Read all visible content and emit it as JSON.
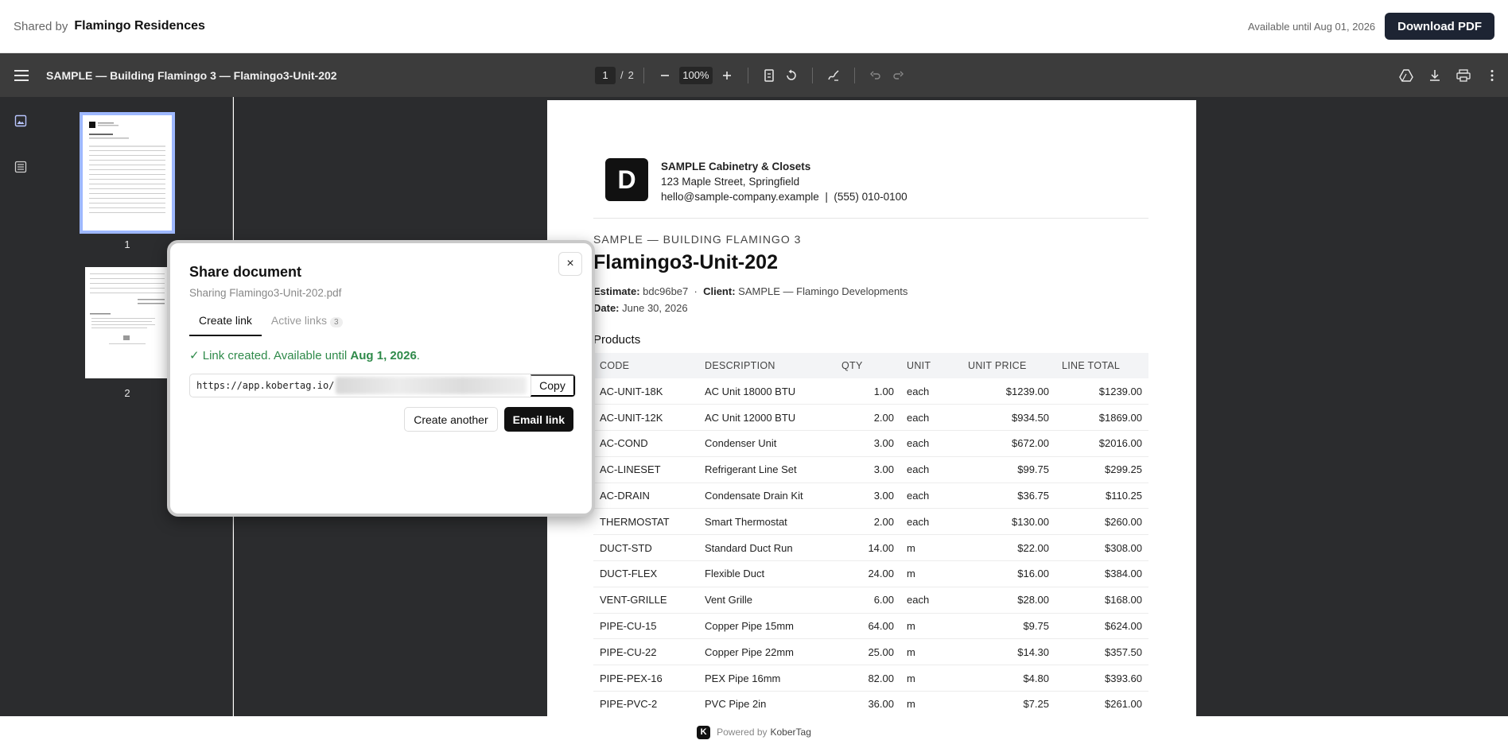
{
  "topbar": {
    "shared_by_label": "Shared by",
    "owner": "Flamingo Residences",
    "available": "Available until Aug 01, 2026",
    "download_label": "Download PDF"
  },
  "toolbar": {
    "doc_title": "SAMPLE — Building Flamingo 3 — Flamingo3-Unit-202",
    "page_current": "1",
    "page_sep": "/",
    "page_total": "2",
    "zoom": "100%"
  },
  "thumbnails": [
    {
      "number": "1",
      "selected": true
    },
    {
      "number": "2",
      "selected": false
    }
  ],
  "document": {
    "logo_letter": "D",
    "company_name": "SAMPLE Cabinetry & Closets",
    "address": "123 Maple Street, Springfield",
    "email": "hello@sample-company.example",
    "phone_sep": "|",
    "phone": "(555) 010-0100",
    "building": "SAMPLE — BUILDING FLAMINGO 3",
    "unit_title": "Flamingo3-Unit-202",
    "estimate_label": "Estimate:",
    "estimate": "bdc96be7",
    "meta_sep": "·",
    "client_label": "Client:",
    "client": "SAMPLE — Flamingo Developments",
    "date_label": "Date:",
    "date": "June 30, 2026",
    "products_heading": "Products",
    "columns": [
      "CODE",
      "DESCRIPTION",
      "QTY",
      "UNIT",
      "UNIT PRICE",
      "LINE TOTAL"
    ],
    "rows": [
      [
        "AC-UNIT-18K",
        "AC Unit 18000 BTU",
        "1.00",
        "each",
        "$1239.00",
        "$1239.00"
      ],
      [
        "AC-UNIT-12K",
        "AC Unit 12000 BTU",
        "2.00",
        "each",
        "$934.50",
        "$1869.00"
      ],
      [
        "AC-COND",
        "Condenser Unit",
        "3.00",
        "each",
        "$672.00",
        "$2016.00"
      ],
      [
        "AC-LINESET",
        "Refrigerant Line Set",
        "3.00",
        "each",
        "$99.75",
        "$299.25"
      ],
      [
        "AC-DRAIN",
        "Condensate Drain Kit",
        "3.00",
        "each",
        "$36.75",
        "$110.25"
      ],
      [
        "THERMOSTAT",
        "Smart Thermostat",
        "2.00",
        "each",
        "$130.00",
        "$260.00"
      ],
      [
        "DUCT-STD",
        "Standard Duct Run",
        "14.00",
        "m",
        "$22.00",
        "$308.00"
      ],
      [
        "DUCT-FLEX",
        "Flexible Duct",
        "24.00",
        "m",
        "$16.00",
        "$384.00"
      ],
      [
        "VENT-GRILLE",
        "Vent Grille",
        "6.00",
        "each",
        "$28.00",
        "$168.00"
      ],
      [
        "PIPE-CU-15",
        "Copper Pipe 15mm",
        "64.00",
        "m",
        "$9.75",
        "$624.00"
      ],
      [
        "PIPE-CU-22",
        "Copper Pipe 22mm",
        "25.00",
        "m",
        "$14.30",
        "$357.50"
      ],
      [
        "PIPE-PEX-16",
        "PEX Pipe 16mm",
        "82.00",
        "m",
        "$4.80",
        "$393.60"
      ],
      [
        "PIPE-PVC-2",
        "PVC Pipe 2in",
        "36.00",
        "m",
        "$7.25",
        "$261.00"
      ]
    ]
  },
  "modal": {
    "title": "Share document",
    "subtitle": "Sharing Flamingo3-Unit-202.pdf",
    "close_glyph": "×",
    "tab_create": "Create link",
    "tab_active": "Active links",
    "tab_active_count": "3",
    "success_prefix": "✓ Link created. Available until ",
    "success_date": "Aug 1, 2026",
    "success_suffix": ".",
    "link_url": "https://app.kobertag.io/",
    "copy_label": "Copy",
    "create_another_label": "Create another",
    "email_link_label": "Email link"
  },
  "footer": {
    "k_letter": "K",
    "powered_by": "Powered by",
    "brand": "KoberTag"
  }
}
